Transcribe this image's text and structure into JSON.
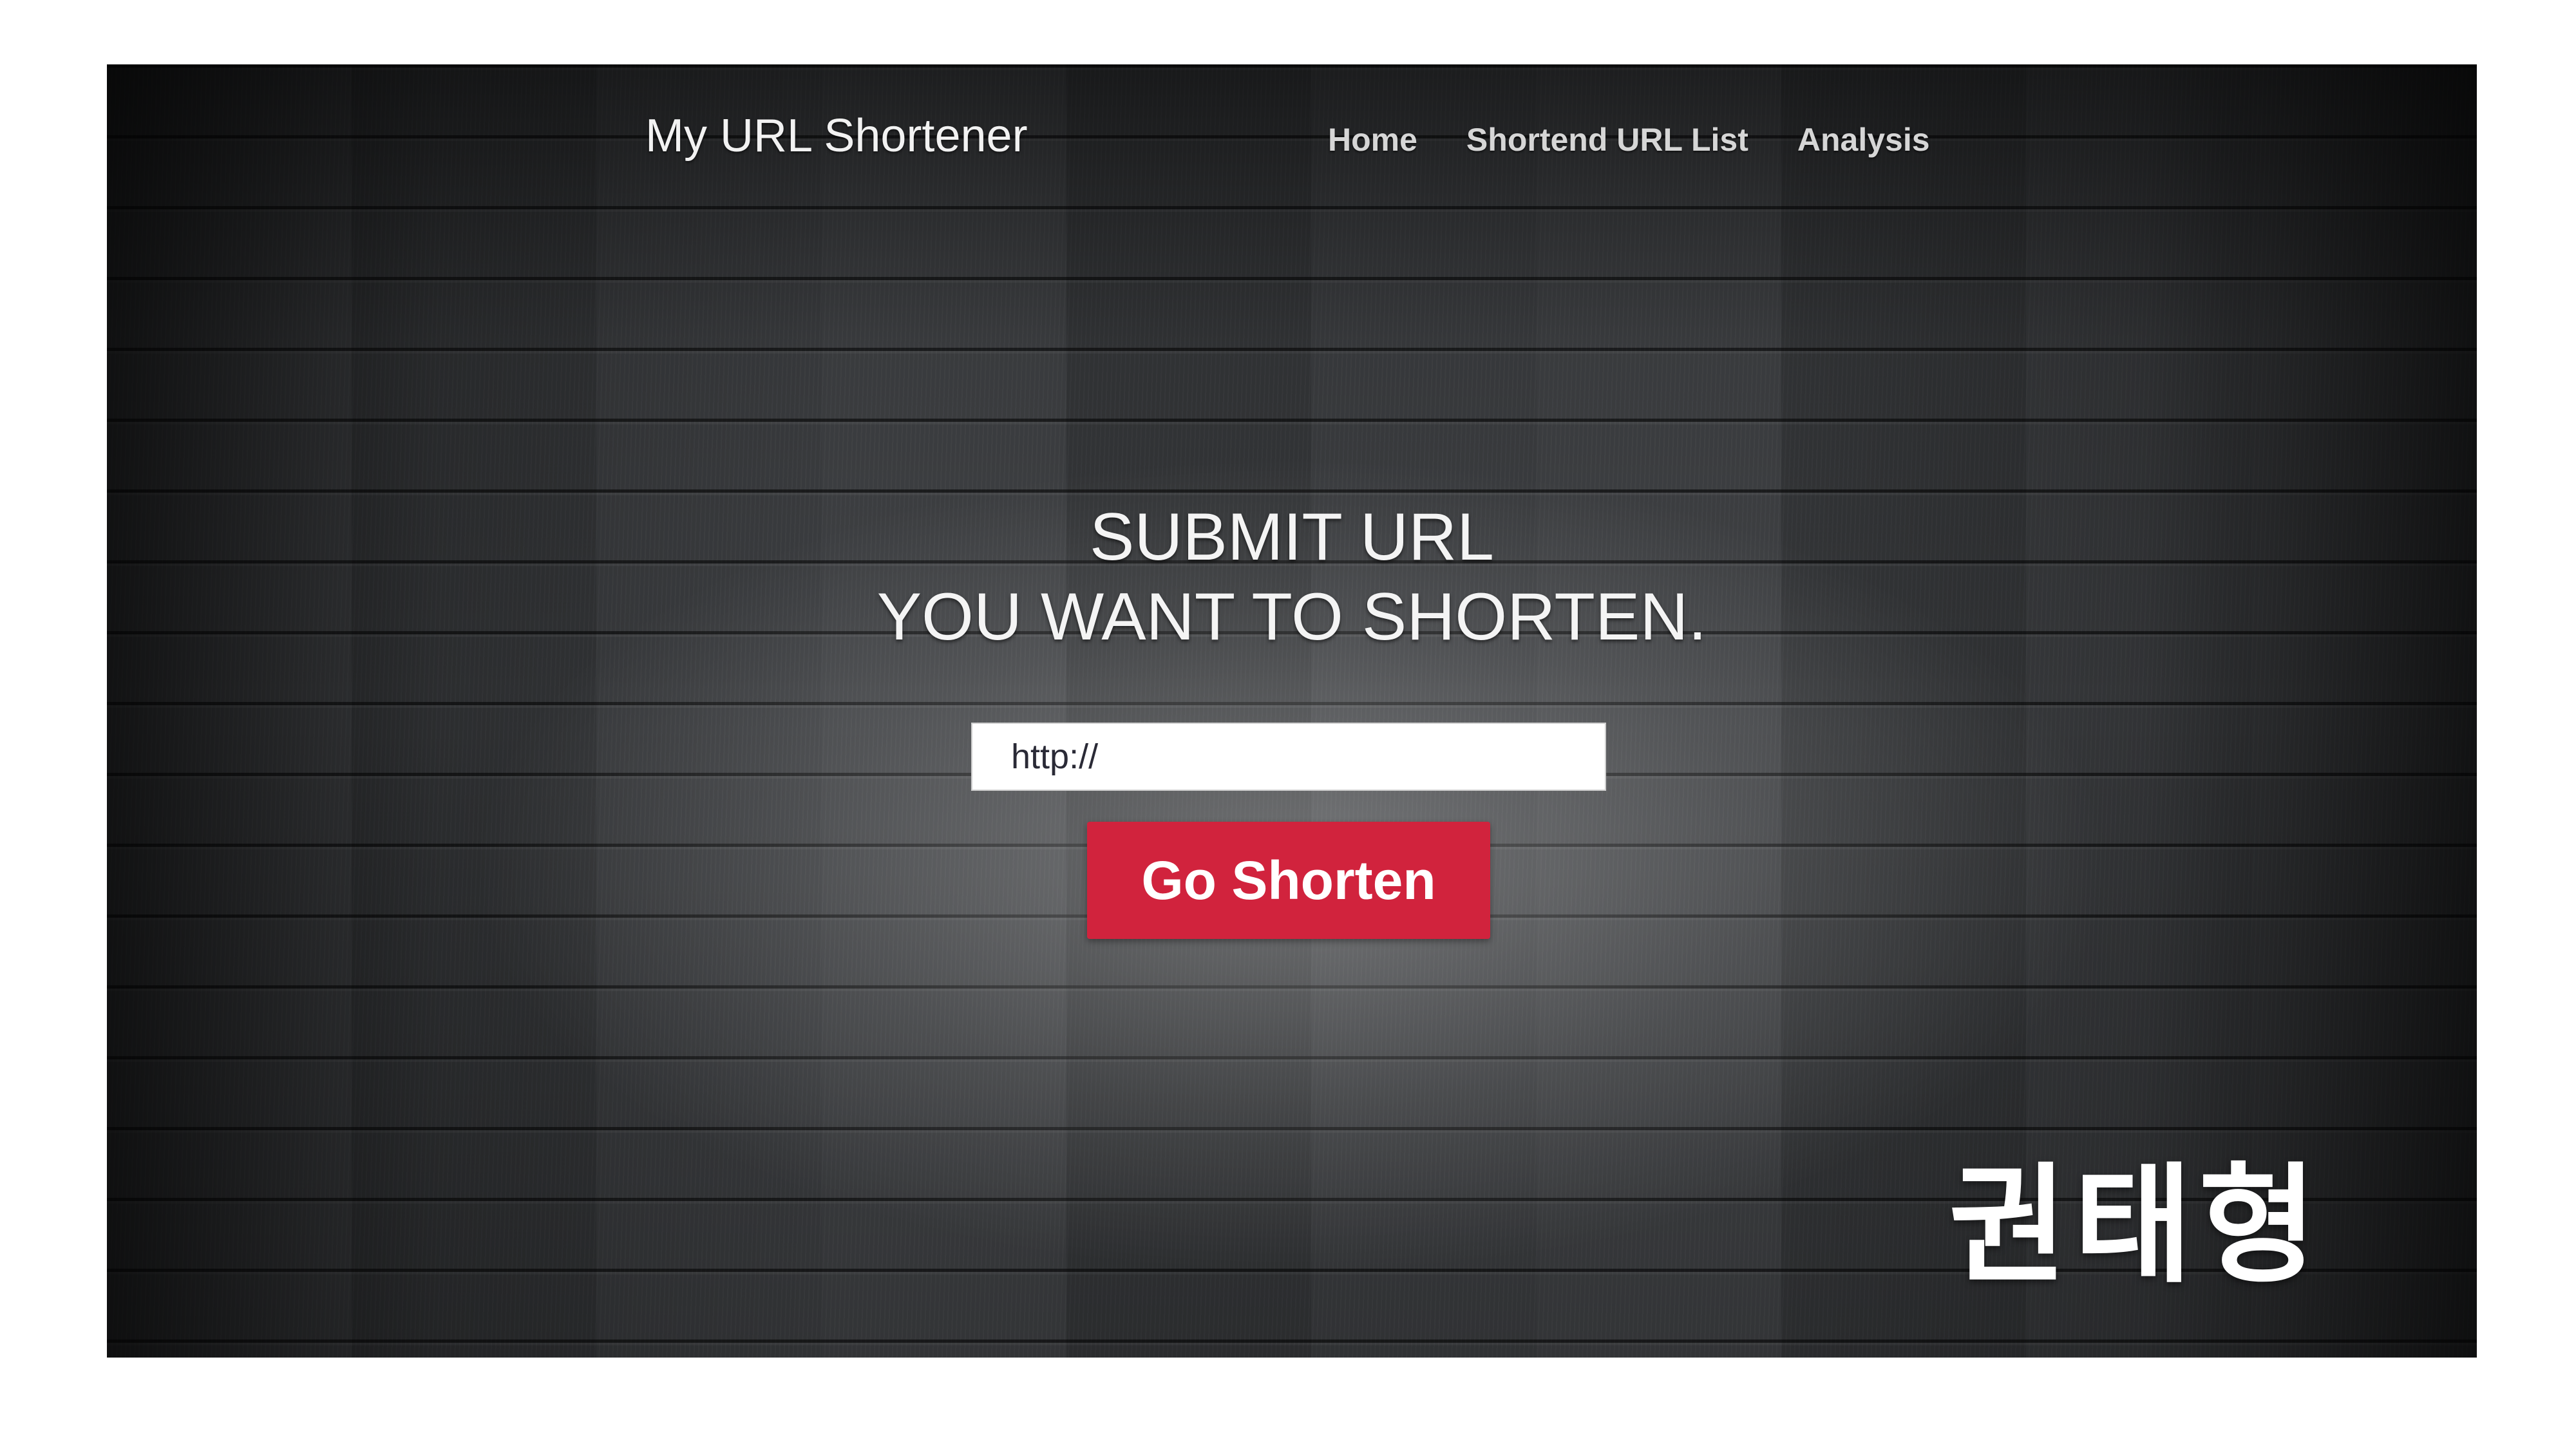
{
  "brand": {
    "title": "My URL Shortener"
  },
  "nav": {
    "items": [
      {
        "label": "Home"
      },
      {
        "label": "Shortend URL List"
      },
      {
        "label": "Analysis"
      }
    ]
  },
  "hero": {
    "line1": "SUBMIT URL",
    "line2": "YOU WANT TO SHORTEN."
  },
  "url_input": {
    "value": "http://",
    "placeholder": "http://"
  },
  "submit": {
    "label": "Go Shorten"
  },
  "author": {
    "name": "권태형"
  },
  "colors": {
    "accent_button": "#d1233d",
    "background": "#3a3c3f",
    "text": "#f4f4f4"
  }
}
